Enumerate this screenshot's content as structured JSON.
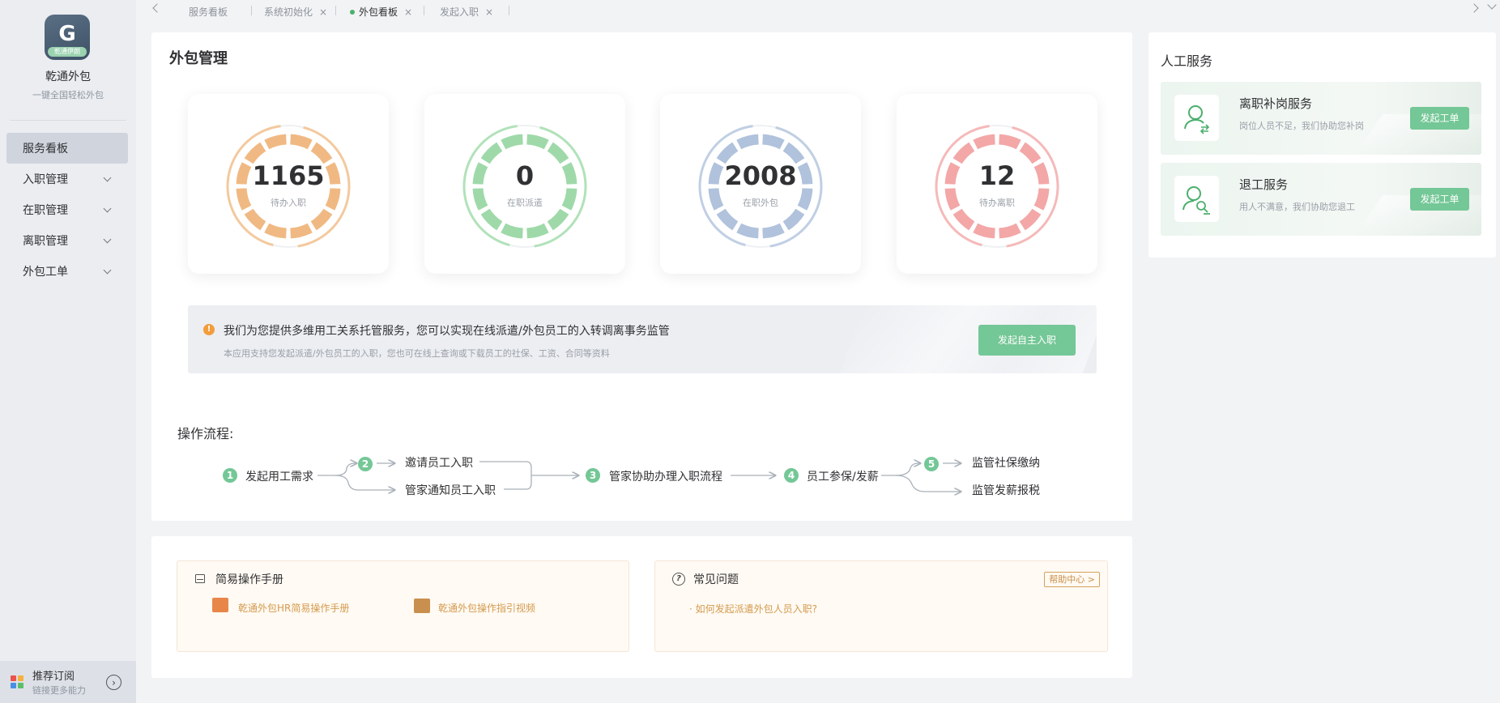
{
  "sidebar": {
    "logo_letter": "G",
    "logo_badge": "乾通伊朗",
    "app_name": "乾通外包",
    "app_slogan": "一键全国轻松外包",
    "nav": [
      {
        "label": "服务看板",
        "active": true,
        "has_children": false
      },
      {
        "label": "入职管理",
        "active": false,
        "has_children": true
      },
      {
        "label": "在职管理",
        "active": false,
        "has_children": true
      },
      {
        "label": "离职管理",
        "active": false,
        "has_children": true
      },
      {
        "label": "外包工单",
        "active": false,
        "has_children": true
      }
    ],
    "footer": {
      "title": "推荐订阅",
      "desc": "链接更多能力",
      "icon": "chevron-right-circle-icon"
    }
  },
  "tabs": [
    {
      "label": "服务看板",
      "closable": false,
      "active": false
    },
    {
      "label": "系统初始化",
      "closable": true,
      "active": false
    },
    {
      "label": "外包看板",
      "closable": true,
      "active": true
    },
    {
      "label": "发起入职",
      "closable": true,
      "active": false
    }
  ],
  "tab_close_glyph": "×",
  "main": {
    "title": "外包管理",
    "stats": [
      {
        "value": "1165",
        "label": "待办入职",
        "color": "#f0b983",
        "ring_color": "#f3c99e"
      },
      {
        "value": "0",
        "label": "在职派遣",
        "color": "#9fd9a9",
        "ring_color": "#b1e2b9"
      },
      {
        "value": "2008",
        "label": "在职外包",
        "color": "#b0c2dc",
        "ring_color": "#c0cfe3"
      },
      {
        "value": "12",
        "label": "待办离职",
        "color": "#f3a7a7",
        "ring_color": "#f5b9b9"
      }
    ],
    "notice": {
      "icon": "warning-icon",
      "main_text": "我们为您提供多维用工关系托管服务，您可以实现在线派遣/外包员工的入转调离事务监管",
      "sub_text": "本应用支持您发起派遣/外包员工的入职，您也可在线上查询或下载员工的社保、工资、合同等资料",
      "button": "发起自主入职"
    },
    "flow": {
      "title": "操作流程:",
      "steps": [
        {
          "num": "1",
          "text": "发起用工需求"
        },
        {
          "num": "2",
          "branches": [
            "邀请员工入职",
            "管家通知员工入职"
          ]
        },
        {
          "num": "3",
          "text": "管家协助办理入职流程"
        },
        {
          "num": "4",
          "text": "员工参保/发薪"
        },
        {
          "num": "5",
          "branches": [
            "监管社保缴纳",
            "监管发薪报税"
          ]
        }
      ]
    }
  },
  "bottom": {
    "manual": {
      "title": "简易操作手册",
      "links": [
        {
          "text": "乾通外包HR简易操作手册",
          "icon": "word-doc-icon"
        },
        {
          "text": "乾通外包操作指引视频",
          "icon": "video-icon"
        }
      ]
    },
    "faq": {
      "title": "常见问题",
      "help_center": "帮助中心 >",
      "items": [
        "· 如何发起派遣外包人员入职?"
      ]
    }
  },
  "right": {
    "title": "人工服务",
    "services": [
      {
        "name": "离职补岗服务",
        "desc": "岗位人员不足，我们协助您补岗",
        "button": "发起工单",
        "icon": "user-swap-icon"
      },
      {
        "name": "退工服务",
        "desc": "用人不满意，我们协助您退工",
        "button": "发起工单",
        "icon": "user-search-icon"
      }
    ]
  },
  "colors": {
    "accent_green": "#74c796",
    "sidebar_bg": "#ebedf1",
    "active_nav": "#cfd4dd",
    "link_orange": "#d49a4e"
  }
}
